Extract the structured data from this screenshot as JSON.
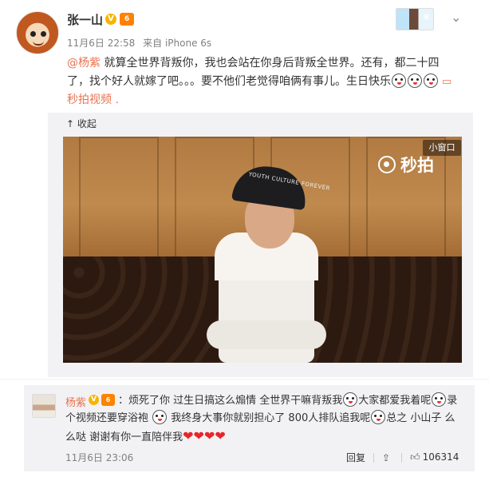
{
  "author": {
    "name": "张一山",
    "verified_badge": "V",
    "vip_badge": "6"
  },
  "meta": {
    "date": "11月6日 22:58",
    "source": "来自 iPhone 6s"
  },
  "post": {
    "mention": "@杨紫",
    "text": " 就算全世界背叛你，我也会站在你身后背叛全世界。还有，都二十四了，找个好人就嫁了吧。。。要不他们老觉得咱俩有事儿。生日快乐",
    "video_link": "秒拍视频",
    "trailing_dot": " ."
  },
  "expand": {
    "collapse_label": "收起",
    "collapse_icon": "↑"
  },
  "video": {
    "mini_window_label": "小窗口",
    "brand_name": "秒拍",
    "cap_text": "YOUTH CULTURE FOREVER"
  },
  "comment": {
    "name": "杨紫",
    "verified_badge": "V",
    "vip_badge": "6",
    "text_part1": "：烦死了你 过生日搞这么煽情 全世界干嘛背叛我",
    "text_part2": "大家都爱我着呢",
    "text_part3": "录个视频还要穿浴袍",
    "text_part4": "我终身大事你就别担心了 800人排队追我呢",
    "text_part5": "总之 小山子 么么哒 谢谢有你一直陪伴我",
    "hearts": "❤❤❤❤",
    "time": "11月6日 23:06",
    "reply_label": "回复",
    "like_count": "106314"
  },
  "colors": {
    "link": "#eb7350",
    "vip_orange": "#ff8200",
    "verified_gold": "#f7b500",
    "box_bg": "#f2f2f5"
  }
}
